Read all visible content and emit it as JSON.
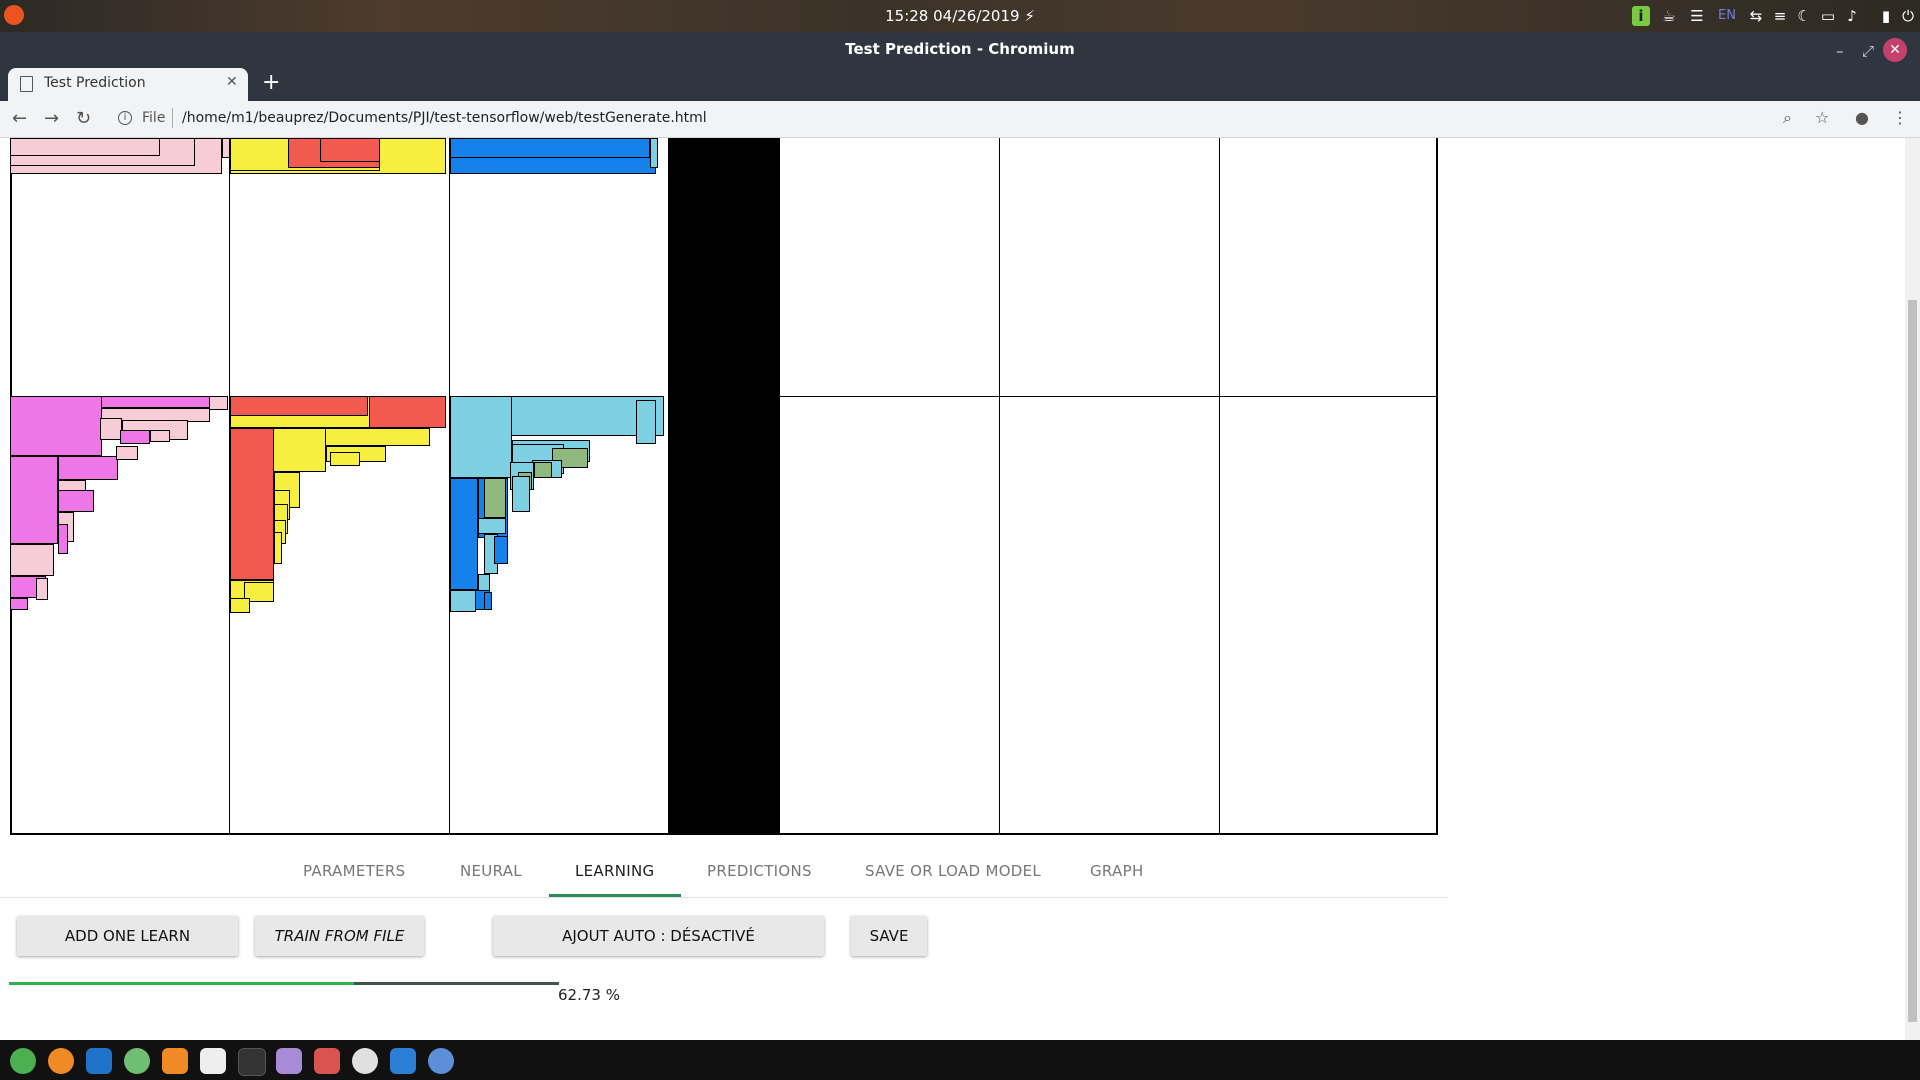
{
  "os_panel": {
    "clock": "15:28 04/26/2019 ⚡",
    "language": "EN"
  },
  "window": {
    "title": "Test Prediction - Chromium"
  },
  "browser": {
    "tab_title": "Test Prediction",
    "url_scheme": "File",
    "url": "/home/m1/beauprez/Documents/PJI/test-tensorflow/web/testGenerate.html"
  },
  "app": {
    "tabs": [
      {
        "label": "PARAMETERS"
      },
      {
        "label": "NEURAL"
      },
      {
        "label": "LEARNING"
      },
      {
        "label": "PREDICTIONS"
      },
      {
        "label": "SAVE OR LOAD MODEL"
      },
      {
        "label": "GRAPH"
      }
    ],
    "active_tab": "LEARNING",
    "buttons": {
      "add_one_learn": "ADD ONE LEARN",
      "train_from_file": "TRAIN FROM FILE",
      "ajout_auto": "AJOUT AUTO : DÉSACTIVÉ",
      "save": "SAVE"
    },
    "progress": {
      "value": 0.6273,
      "label": "62.73 %"
    }
  },
  "colors": {
    "pink": "#f6ccd6",
    "magenta": "#ee76e6",
    "yellow": "#f7ef3f",
    "red": "#f2594f",
    "blue": "#1482ea",
    "light_blue": "#7fcfe3",
    "green": "#8fb87f",
    "accent": "#2e8b57"
  },
  "icons": [
    "ubuntu-icon",
    "chrome-icon",
    "firefox-icon",
    "vscode-icon",
    "atom-icon",
    "vlc-icon",
    "calendar-icon",
    "terminal-icon",
    "files-icon",
    "image-viewer-icon",
    "java-icon",
    "text-editor-icon",
    "chromium-icon"
  ]
}
